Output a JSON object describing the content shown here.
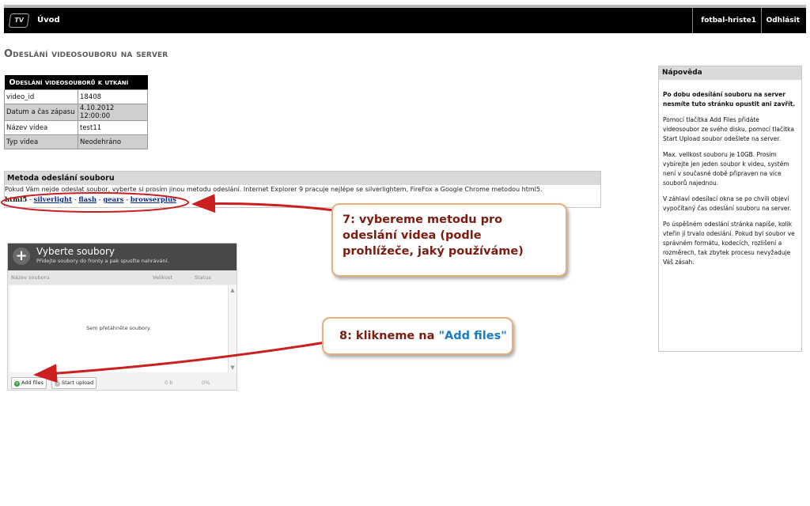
{
  "topbar": {
    "logo_text": "TV",
    "home_label": "Úvod",
    "user_label": "fotbal-hriste1",
    "logout_label": "Odhlásit"
  },
  "page_title": "Odeslání videosouboru na server",
  "info_table": {
    "header": "Odeslání videosouborů k utkání",
    "rows": [
      {
        "key": "video_id",
        "value": "18408"
      },
      {
        "key": "Datum a čas zápasu",
        "value": "4.10.2012 12:00:00"
      },
      {
        "key": "Název videa",
        "value": "test11"
      },
      {
        "key": "Typ videa",
        "value": "Neodehráno"
      }
    ]
  },
  "method": {
    "title": "Metoda odeslání souboru",
    "description": "Pokud Vám nejde odeslat soubor, vyberte si prosím jinou metodu odeslání. Internet Explorer 9 pracuje nejlépe se silverlightem, FireFox a Google Chrome metodou html5.",
    "current": "html5",
    "separator": " - ",
    "links": [
      "silverlight",
      "flash",
      "gears",
      "browserplus"
    ]
  },
  "uploader": {
    "title": "Vyberte soubory",
    "subtitle": "Přidejte soubory do fronty a pak spusťte nahrávání.",
    "col_name": "Název souboru",
    "col_size": "Velikost",
    "col_status": "Status",
    "drop_text": "Sem přetáhněte soubory.",
    "add_label": "Add files",
    "start_label": "Start upload",
    "total_size": "0 b",
    "total_percent": "0%"
  },
  "callouts": {
    "step7": "7: vybereme metodu pro odeslání videa (podle  prohlížeče, jaký používáme)",
    "step8_prefix": "8: klikneme na ",
    "step8_quoted": "\"Add files\""
  },
  "help": {
    "title": "Nápověda",
    "paragraphs": [
      "Po dobu odesílání souboru na server nesmíte tuto stránku opustit ani zavřít.",
      "Pomocí tlačítka Add Files přidáte videosoubor ze svého disku, pomocí tlačítka Start Upload soubor odešlete na server.",
      "Max. velikost souboru je 10GB. Prosím vybírejte jen jeden soubor k videu, systém není v současné době připraven na více souborů najednou.",
      "V záhlaví odesílací okna se po chvíli objeví vypočítaný čas odeslání souboru na server.",
      "Po úspěšném odeslání stránka napíše, kolik vteřin jí trvalo odeslání. Pokud byl soubor ve správném formátu, kodecích, rozlišení a rozměrech, tak zbytek procesu nevyžaduje Váš zásah."
    ]
  },
  "colors": {
    "callout_text": "#7d1b10",
    "callout_border": "#e7b07a",
    "arrow": "#cc1f1f",
    "link": "#0a2a8f",
    "highlight_blue": "#1b7bc4"
  }
}
